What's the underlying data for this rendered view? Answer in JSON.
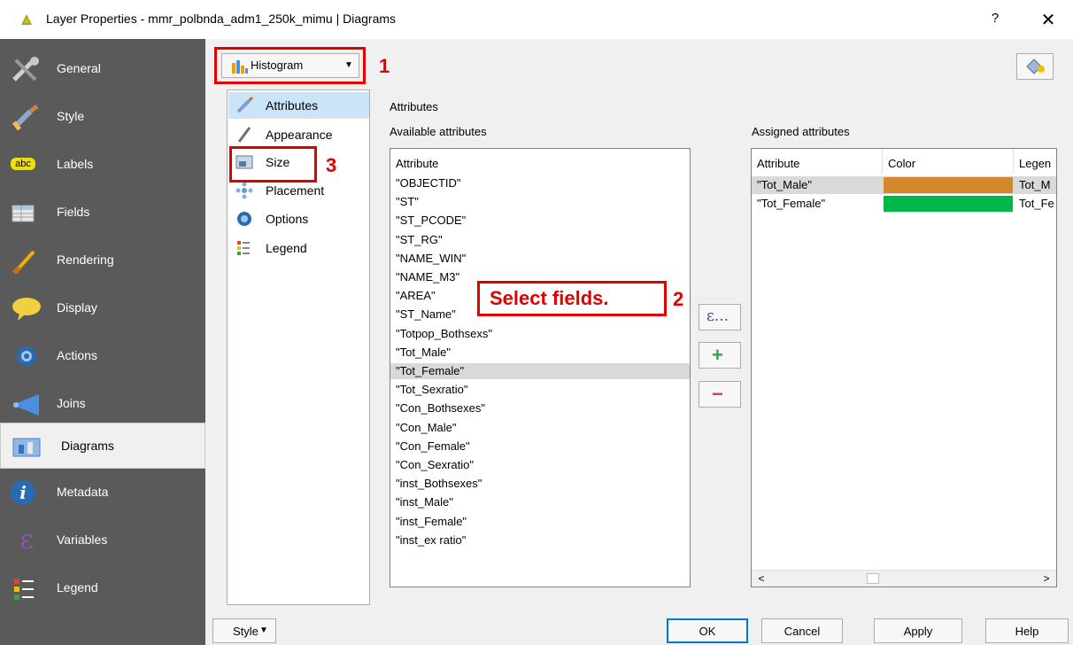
{
  "window": {
    "title": "Layer Properties - mmr_polbnda_adm1_250k_mimu | Diagrams",
    "help_label": "?",
    "close_label": "✕"
  },
  "sidebar": {
    "items": [
      {
        "label": "General",
        "icon": "tools-icon"
      },
      {
        "label": "Style",
        "icon": "paintbrush-icon"
      },
      {
        "label": "Labels",
        "icon": "abc-label-icon",
        "badge": "abc"
      },
      {
        "label": "Fields",
        "icon": "table-icon"
      },
      {
        "label": "Rendering",
        "icon": "brush-icon"
      },
      {
        "label": "Display",
        "icon": "speech-bubble-icon"
      },
      {
        "label": "Actions",
        "icon": "gear-action-icon"
      },
      {
        "label": "Joins",
        "icon": "join-icon"
      },
      {
        "label": "Diagrams",
        "icon": "diagram-icon",
        "active": true
      },
      {
        "label": "Metadata",
        "icon": "info-icon",
        "glyph": "i"
      },
      {
        "label": "Variables",
        "icon": "epsilon-icon",
        "glyph": "ε"
      },
      {
        "label": "Legend",
        "icon": "legend-icon"
      }
    ]
  },
  "diagram_type": {
    "selected": "Histogram"
  },
  "annotations": {
    "callout_1": "1",
    "callout_2": "2",
    "callout_3": "3",
    "select_fields": "Select fields."
  },
  "subnav": {
    "items": [
      {
        "label": "Attributes",
        "active": true
      },
      {
        "label": "Appearance"
      },
      {
        "label": "Size"
      },
      {
        "label": "Placement"
      },
      {
        "label": "Options"
      },
      {
        "label": "Legend"
      }
    ]
  },
  "attributes_panel": {
    "section_title": "Attributes",
    "available_label": "Available attributes",
    "assigned_label": "Assigned attributes",
    "list_header": "Attribute",
    "available": [
      "\"OBJECTID\"",
      "\"ST\"",
      "\"ST_PCODE\"",
      "\"ST_RG\"",
      "\"NAME_WIN\"",
      "\"NAME_M3\"",
      "\"AREA\"",
      "\"ST_Name\"",
      "\"Totpop_Bothsexs\"",
      "\"Tot_Male\"",
      "\"Tot_Female\"",
      "\"Tot_Sexratio\"",
      "\"Con_Bothsexes\"",
      "\"Con_Male\"",
      "\"Con_Female\"",
      "\"Con_Sexratio\"",
      "\"inst_Bothsexes\"",
      "\"inst_Male\"",
      "\"inst_Female\"",
      "\"inst_ex ratio\""
    ],
    "selected_available": "\"Tot_Female\"",
    "middle_buttons": {
      "expression": "ε...",
      "add": "+",
      "remove": "−"
    },
    "assigned_columns": [
      "Attribute",
      "Color",
      "Legen"
    ],
    "assigned": [
      {
        "attribute": "\"Tot_Male\"",
        "color": "#d4882c",
        "legend": "Tot_M",
        "selected": true
      },
      {
        "attribute": "\"Tot_Female\"",
        "color": "#00b84a",
        "legend": "Tot_Fe"
      }
    ],
    "scroll_left": "<",
    "scroll_right": ">"
  },
  "footer": {
    "style_label": "Style",
    "ok_label": "OK",
    "cancel_label": "Cancel",
    "apply_label": "Apply",
    "help_label": "Help"
  }
}
